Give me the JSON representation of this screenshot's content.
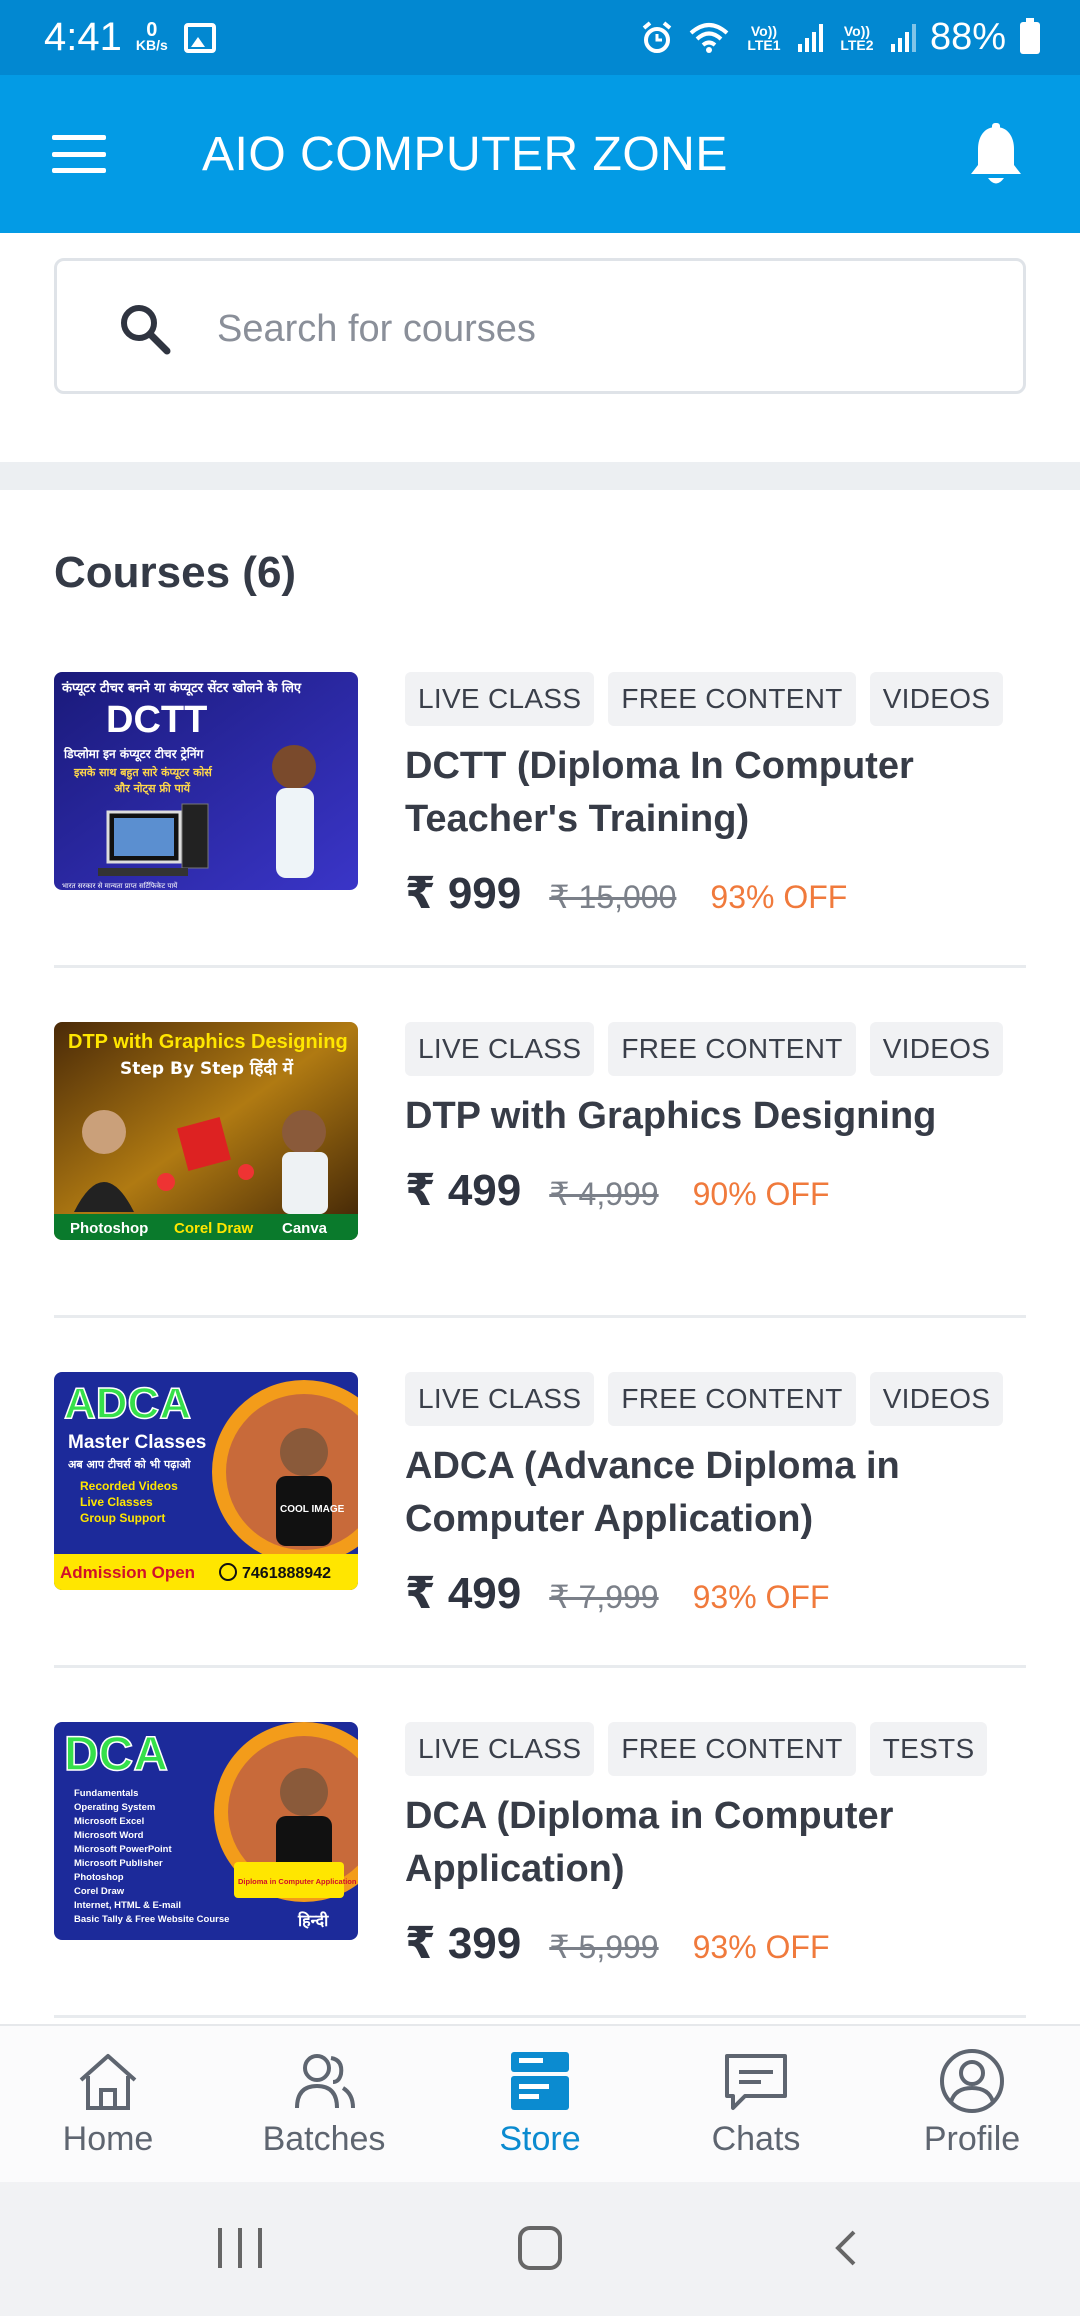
{
  "status_bar": {
    "time": "4:41",
    "speed_value": "0",
    "speed_unit": "KB/s",
    "net1": "Vo)) LTE1",
    "net2": "Vo)) LTE2",
    "battery": "88%"
  },
  "app_bar": {
    "title": "AIO COMPUTER ZONE",
    "menu_icon": "hamburger-icon",
    "notification_icon": "bell-icon"
  },
  "search": {
    "placeholder": "Search for courses",
    "value": ""
  },
  "courses_section": {
    "title": "Courses (6)"
  },
  "courses": [
    {
      "tags": [
        "LIVE CLASS",
        "FREE CONTENT",
        "VIDEOS"
      ],
      "title": "DCTT (Diploma In Computer Teacher's Training)",
      "price": "₹ 999",
      "mrp": "₹ 15,000",
      "discount": "93% OFF",
      "thumb": {
        "header": "कंप्यूटर टीचर बनने या कंप्यूटर सेंटर खोलने के लिए",
        "name": "DCTT",
        "line1": "डिप्लोमा इन कंप्यूटर टीचर ट्रेनिंग",
        "line2": "इसके साथ बहुत सारे कंप्यूटर कोर्स",
        "line3": "और नोट्स फ्री पायें",
        "note": "भारत सरकार से मान्यता प्राप्त सर्टिफिकेट पायें"
      }
    },
    {
      "tags": [
        "LIVE CLASS",
        "FREE CONTENT",
        "VIDEOS"
      ],
      "title": "DTP with Graphics Designing",
      "price": "₹ 499",
      "mrp": "₹ 4,999",
      "discount": "90% OFF",
      "thumb": {
        "header": "DTP with Graphics Designing",
        "sub": "Step By Step हिंदी में",
        "footer": [
          "Photoshop",
          "Corel Draw",
          "Canva"
        ]
      }
    },
    {
      "tags": [
        "LIVE CLASS",
        "FREE CONTENT",
        "VIDEOS"
      ],
      "title": "ADCA (Advance Diploma in Computer Application)",
      "price": "₹ 499",
      "mrp": "₹ 7,999",
      "discount": "93% OFF",
      "thumb": {
        "name": "ADCA",
        "sub": "Master Classes",
        "line": "अब आप टीचर्स को भी पढ़ाओ",
        "bullets": [
          "Recorded Videos",
          "Live Classes",
          "Group Support"
        ],
        "footer_left": "Admission Open",
        "footer_right": "7461888942",
        "badge": "COOL IMAGE"
      }
    },
    {
      "tags": [
        "LIVE CLASS",
        "FREE CONTENT",
        "TESTS"
      ],
      "title": "DCA (Diploma in Computer Application)",
      "price": "₹ 399",
      "mrp": "₹ 5,999",
      "discount": "93% OFF",
      "thumb": {
        "name": "DCA",
        "bullets": [
          "Fundamentals",
          "Operating System",
          "Microsoft Excel",
          "Microsoft Word",
          "Microsoft PowerPoint",
          "Microsoft Publisher",
          "Photoshop",
          "Corel Draw",
          "Internet, HTML & E-mail",
          "Basic Tally & Free Website Course"
        ],
        "badge": "Diploma in Computer Application",
        "lang": "हिन्दी"
      }
    }
  ],
  "bottom_nav": [
    {
      "label": "Home",
      "icon": "home-icon"
    },
    {
      "label": "Batches",
      "icon": "batches-icon"
    },
    {
      "label": "Store",
      "icon": "store-icon",
      "active": true
    },
    {
      "label": "Chats",
      "icon": "chat-icon"
    },
    {
      "label": "Profile",
      "icon": "profile-icon"
    }
  ],
  "colors": {
    "status_bar": "#0288d1",
    "app_bar": "#039be5",
    "discount": "#f07a3c",
    "active_nav": "#0b8bd0"
  }
}
